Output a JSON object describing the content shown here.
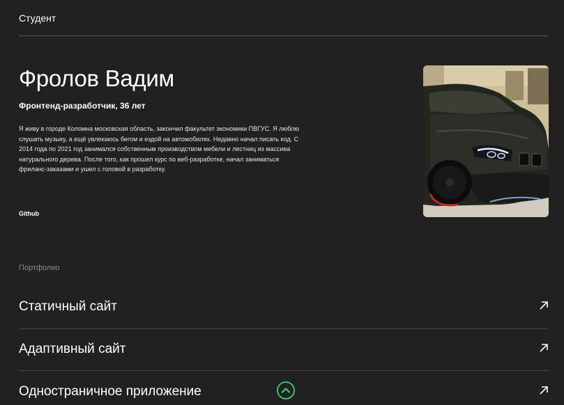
{
  "header": {
    "title": "Студент"
  },
  "profile": {
    "name": "Фролов Вадим",
    "role": "Фронтенд-разработчик, 36 лет",
    "about": "Я живу в городе Коломна московская область, закончил факультет экономики ПВГУС. Я люблю слушать музыку, а ещё увлекаюсь бегом и ездой на автомобилях. Недавно начал писать код. С 2014 года по 2021 год занимался собственным производством мебели и лестниц из массива натурального дерева. После того, как прошел курс по веб-разработке, начал заниматься фриланс-заказами и ушел с головой в разработку.",
    "github_label": "Github",
    "photo_icon": "car-photo"
  },
  "portfolio": {
    "title": "Портфолио",
    "items": [
      {
        "label": "Статичный сайт",
        "icon": "arrow-up-right-icon"
      },
      {
        "label": "Адаптивный сайт",
        "icon": "arrow-up-right-icon"
      },
      {
        "label": "Одностраничное приложение",
        "icon": "arrow-up-right-icon"
      }
    ]
  },
  "scroll_up": {
    "icon": "chevron-up-icon",
    "color": "#3fbf6a"
  }
}
